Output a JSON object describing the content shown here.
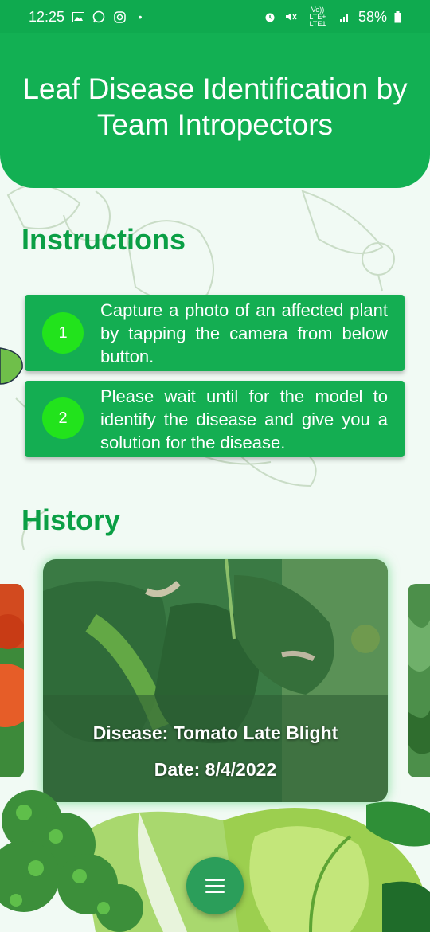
{
  "status_bar": {
    "time": "12:25",
    "battery": "58%",
    "network": "Vo)) LTE+ LTE1",
    "icons": [
      "gallery-icon",
      "whatsapp-icon",
      "instagram-icon",
      "dot-icon",
      "alarm-icon",
      "mute-icon",
      "signal-icon",
      "battery-icon"
    ]
  },
  "header": {
    "title": "Leaf Disease Identification by Team Intropectors"
  },
  "instructions": {
    "title": "Instructions",
    "steps": [
      {
        "number": "1",
        "text": "Capture a photo of an affected plant by tapping the camera from below button."
      },
      {
        "number": "2",
        "text": "Please wait until for the model to identify the disease and give you a solution for the disease."
      }
    ]
  },
  "history": {
    "title": "History",
    "items": [
      {
        "disease": "Disease: Tomato Late Blight",
        "date": "Date: 8/4/2022"
      }
    ]
  },
  "fab": {
    "icon": "menu-icon"
  },
  "colors": {
    "primary": "#12b053",
    "status_bar": "#0faa4f",
    "step_circle": "#22e31c",
    "title_text": "#0b9f45",
    "background": "#f1faf4"
  }
}
